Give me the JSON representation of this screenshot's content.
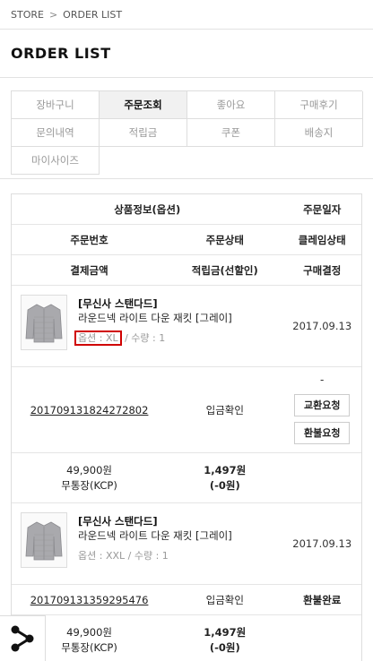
{
  "breadcrumb": {
    "home": "STORE",
    "separator": ">",
    "current": "ORDER LIST"
  },
  "page_title": "ORDER LIST",
  "tabs": [
    {
      "label": "장바구니",
      "active": false
    },
    {
      "label": "주문조회",
      "active": true
    },
    {
      "label": "좋아요",
      "active": false
    },
    {
      "label": "구매후기",
      "active": false
    },
    {
      "label": "문의내역",
      "active": false
    },
    {
      "label": "적립금",
      "active": false
    },
    {
      "label": "쿠폰",
      "active": false
    },
    {
      "label": "배송지",
      "active": false
    },
    {
      "label": "마이사이즈",
      "active": false
    }
  ],
  "table_header": {
    "product_info": "상품정보(옵션)",
    "order_date": "주문일자",
    "order_number": "주문번호",
    "order_status": "주문상태",
    "claim_status": "클레임상태",
    "payment_amount": "결제금액",
    "points": "적립금(선할인)",
    "purchase_confirm": "구매결정"
  },
  "orders": [
    {
      "brand": "[무신사 스탠다드]",
      "product_name": "라운드넥 라이트 다운 재킷 [그레이]",
      "option": "옵션 : XL",
      "quantity": " / 수량 : 1",
      "date": "2017.09.13",
      "order_number": "201709131824272802",
      "status": "입금확인",
      "claim_dash": "-",
      "exchange_btn": "교환요청",
      "refund_btn": "환불요청",
      "price": "49,900원",
      "pay_method": "무통장(KCP)",
      "points": "1,497원",
      "points_discount": "(-0원)"
    },
    {
      "brand": "[무신사 스탠다드]",
      "product_name": "라운드넥 라이트 다운 재킷 [그레이]",
      "option": "옵션 : XXL / 수량 : 1",
      "date": "2017.09.13",
      "order_number": "201709131359295476",
      "status": "입금확인",
      "claim": "환불완료",
      "price": "49,900원",
      "pay_method": "무통장(KCP)",
      "points": "1,497원",
      "points_discount": "(-0원)"
    }
  ],
  "colors": {
    "highlight": "#d00000",
    "active_tab_bg": "#f1f1f1"
  },
  "icons": {
    "share": "share-icon",
    "thumbnail": "jacket-thumbnail"
  }
}
